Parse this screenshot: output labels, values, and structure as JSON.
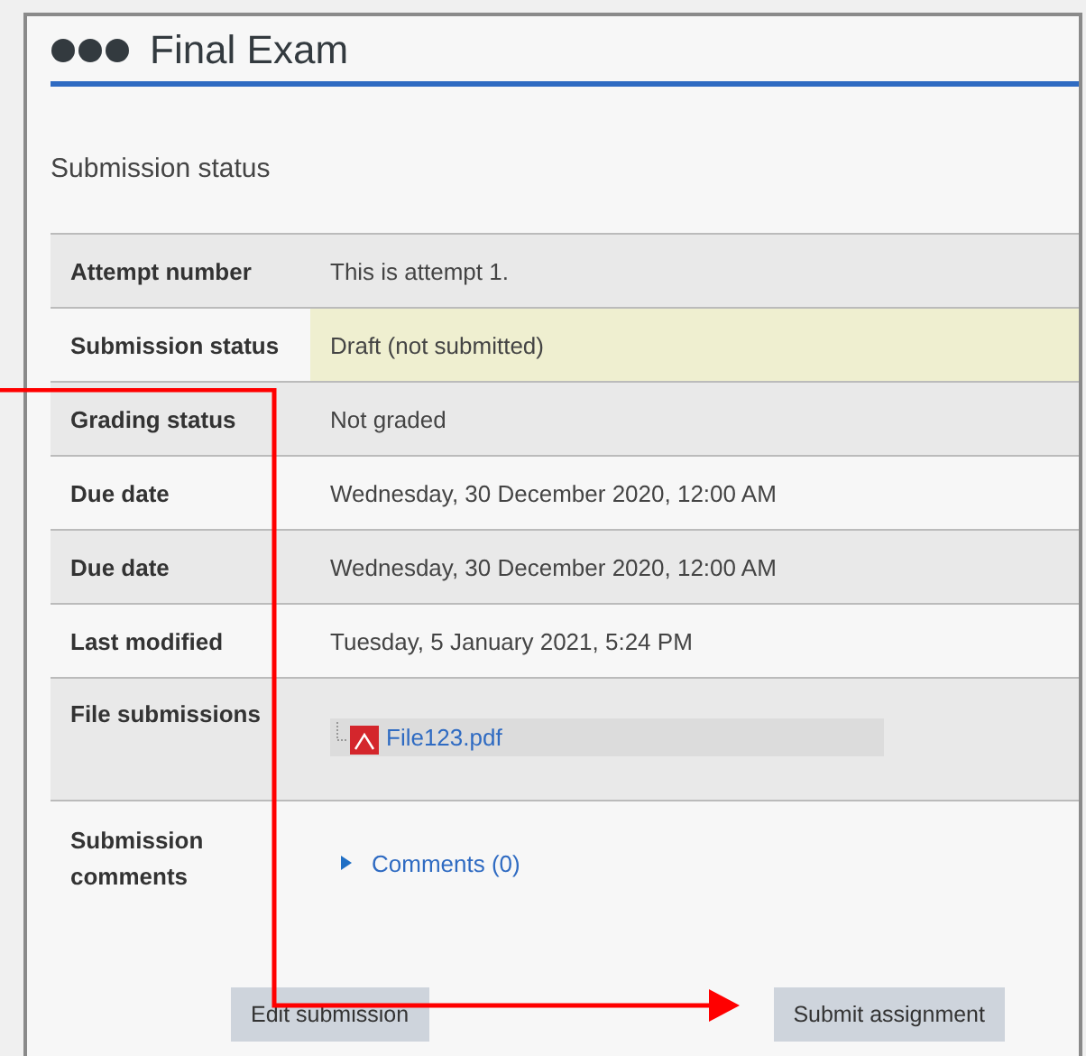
{
  "title": "Final Exam",
  "section_heading": "Submission status",
  "rows": [
    {
      "kind": "text",
      "label": "Attempt number",
      "value": "This is attempt 1.",
      "highlighted": false
    },
    {
      "kind": "text",
      "label": "Submission status",
      "value": "Draft (not submitted)",
      "highlighted": true
    },
    {
      "kind": "text",
      "label": "Grading status",
      "value": "Not graded",
      "highlighted": false
    },
    {
      "kind": "text",
      "label": "Due date",
      "value": "Wednesday, 30 December 2020, 12:00 AM",
      "highlighted": false
    },
    {
      "kind": "text",
      "label": "Due date",
      "value": "Wednesday, 30 December 2020, 12:00 AM",
      "highlighted": false
    },
    {
      "kind": "text",
      "label": "Last modified",
      "value": "Tuesday, 5 January 2021, 5:24 PM",
      "highlighted": false
    },
    {
      "kind": "file",
      "label": "File submissions",
      "value": "File123.pdf",
      "highlighted": false
    },
    {
      "kind": "comments",
      "label": "Submission comments",
      "value": "Comments (0)",
      "highlighted": false,
      "expanded": false
    }
  ],
  "buttons": [
    "Edit submission",
    "Submit assignment"
  ]
}
